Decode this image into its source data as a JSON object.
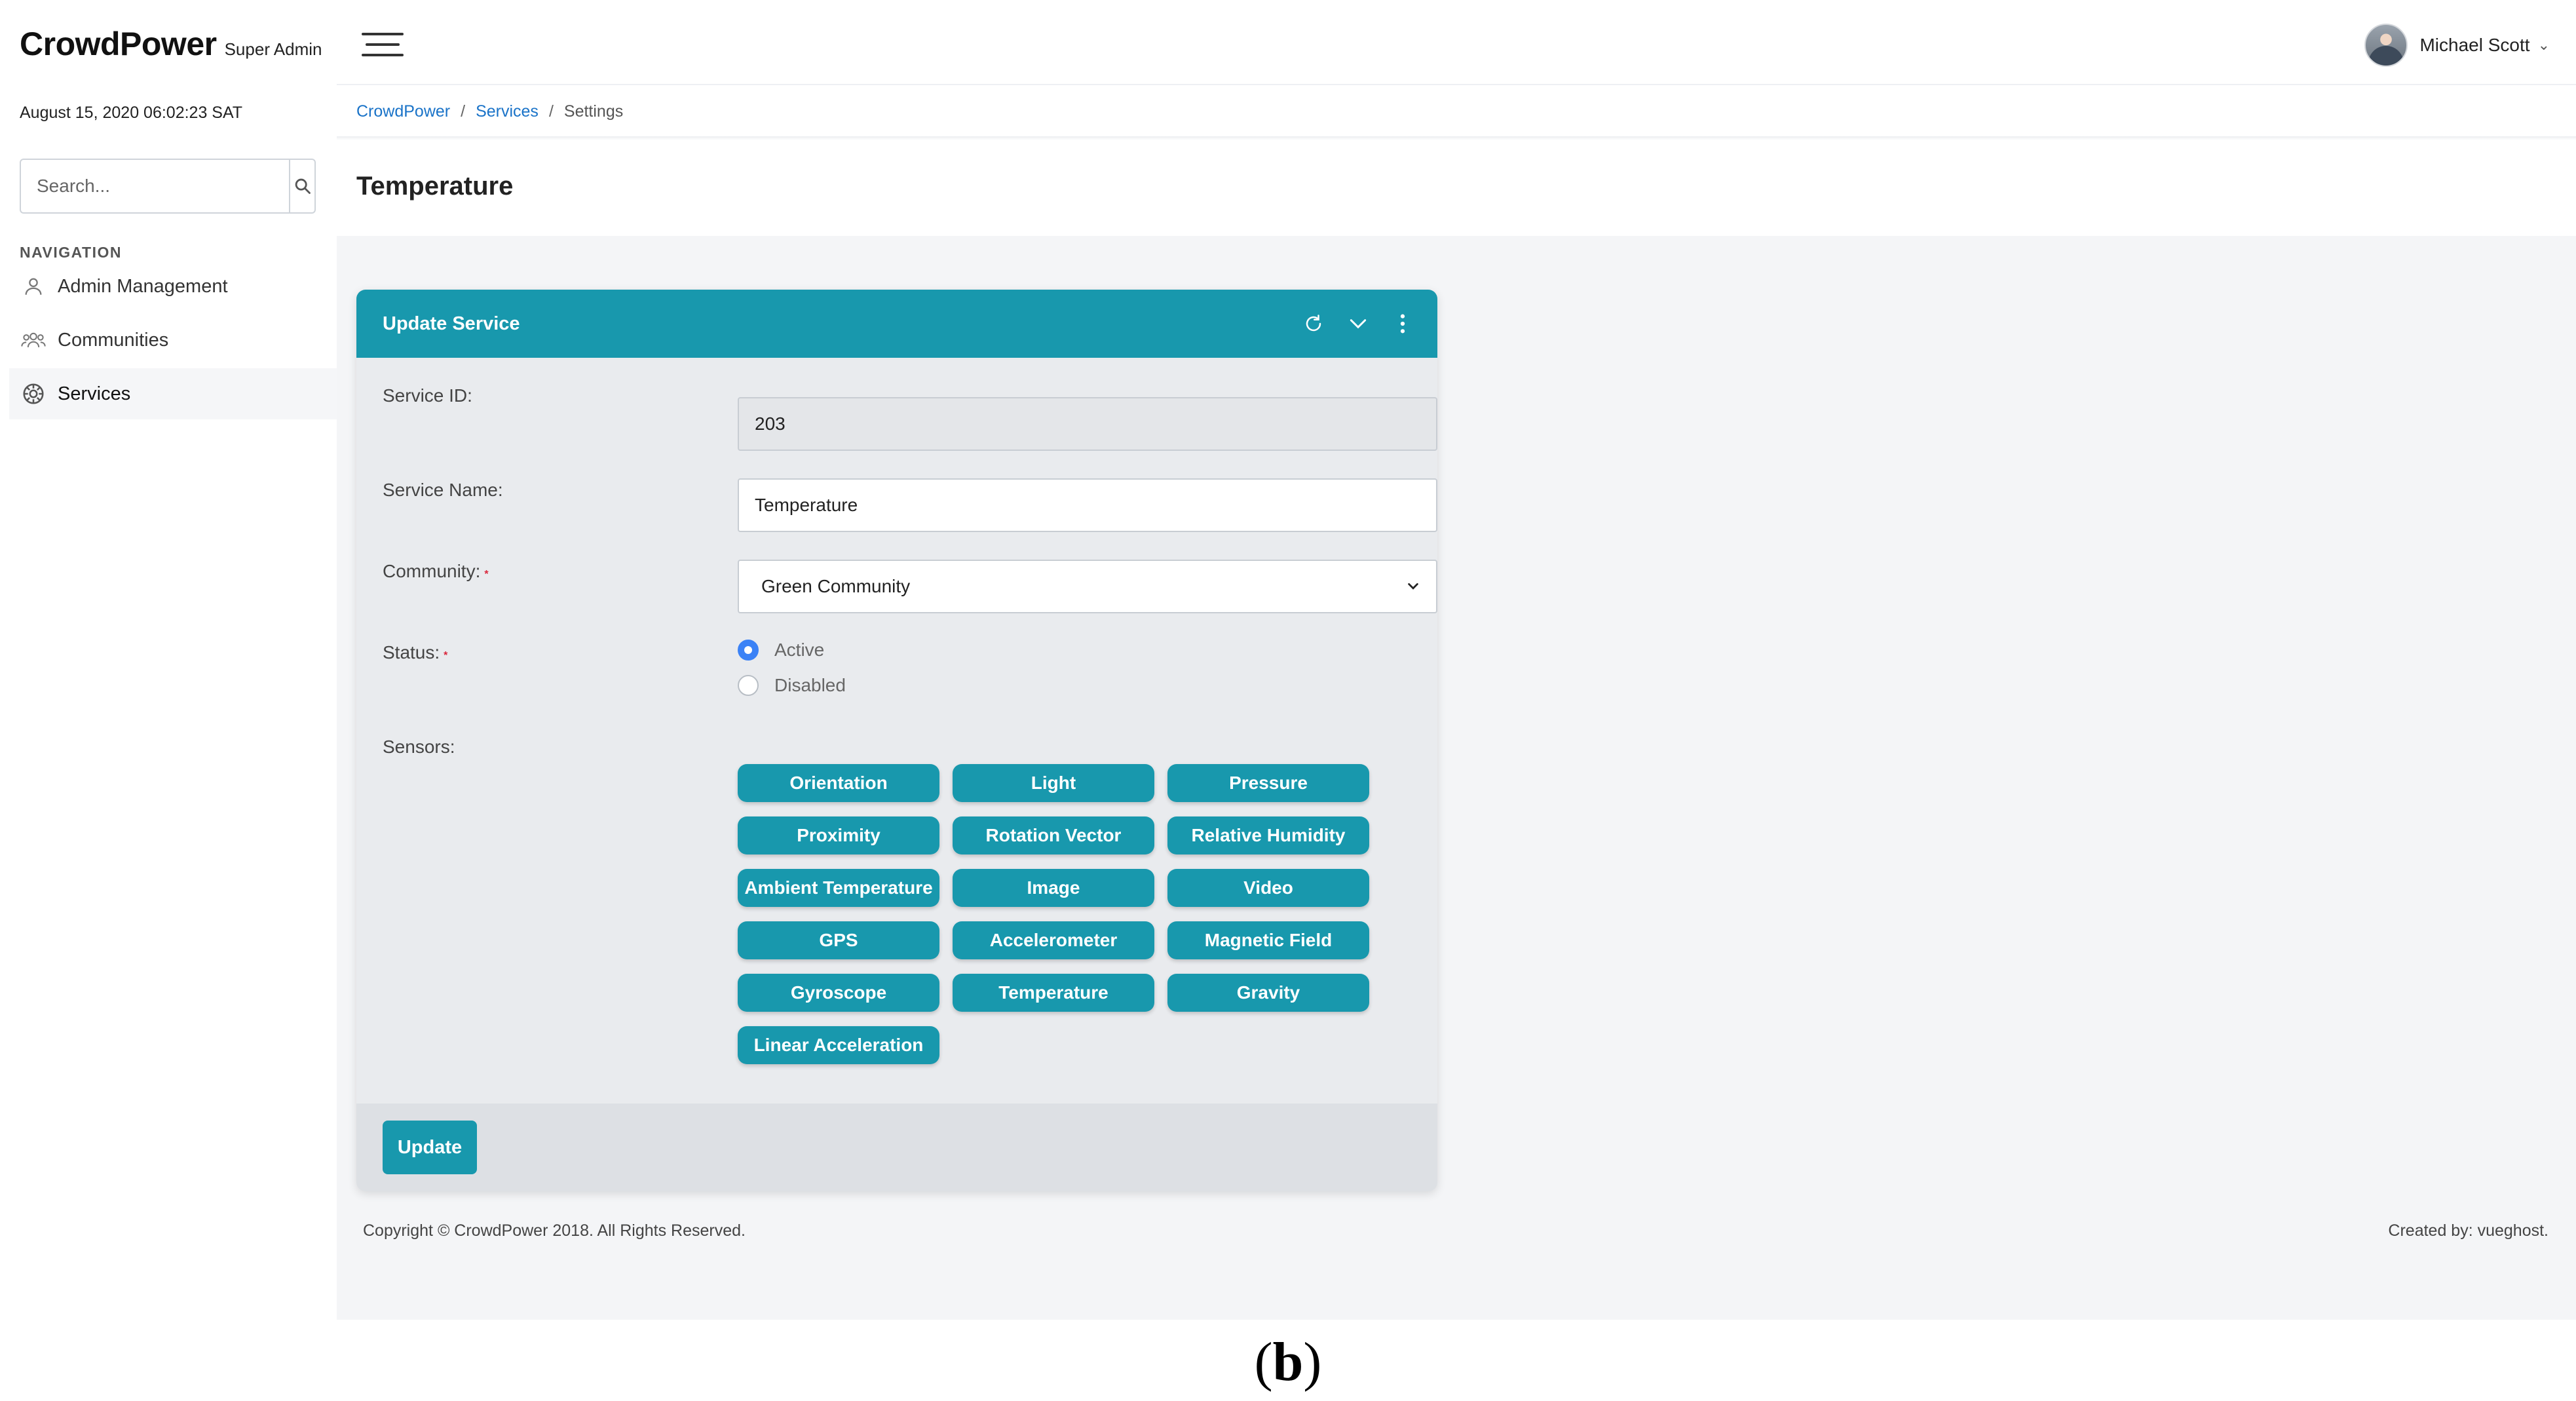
{
  "brand": {
    "name": "CrowdPower",
    "role": "Super Admin"
  },
  "user": {
    "name": "Michael Scott",
    "caret": "⌄"
  },
  "sidebar": {
    "datetime": "August 15, 2020 06:02:23 SAT",
    "search_placeholder": "Search...",
    "nav_heading": "NAVIGATION",
    "items": [
      {
        "label": "Admin Management",
        "icon": "user-icon"
      },
      {
        "label": "Communities",
        "icon": "users-icon"
      },
      {
        "label": "Services",
        "icon": "gear-icon",
        "active": true
      }
    ]
  },
  "breadcrumb": {
    "home": "CrowdPower",
    "section": "Services",
    "current": "Settings",
    "separator": "/"
  },
  "page": {
    "title": "Temperature"
  },
  "card": {
    "title": "Update Service",
    "service_id_label": "Service ID:",
    "service_id_value": "203",
    "service_name_label": "Service Name:",
    "service_name_value": "Temperature",
    "community_label": "Community:",
    "community_value": "Green Community",
    "status_label": "Status:",
    "status_options": [
      "Active",
      "Disabled"
    ],
    "status_selected": "Active",
    "required_mark": "*",
    "sensors_label": "Sensors:",
    "sensors": [
      "Orientation",
      "Light",
      "Pressure",
      "Proximity",
      "Rotation Vector",
      "Relative Humidity",
      "Ambient Temperature",
      "Image",
      "Video",
      "GPS",
      "Accelerometer",
      "Magnetic Field",
      "Gyroscope",
      "Temperature",
      "Gravity",
      "Linear Acceleration"
    ],
    "update_label": "Update"
  },
  "footer": {
    "copyright": "Copyright © CrowdPower 2018. All Rights Reserved.",
    "created_by": "Created by: vueghost."
  },
  "caption": {
    "open": "(",
    "letter": "b",
    "close": ")"
  },
  "colors": {
    "accent": "#1898ad",
    "link": "#1a73c8",
    "required": "#d9253a",
    "radio_checked": "#3b82f6"
  }
}
